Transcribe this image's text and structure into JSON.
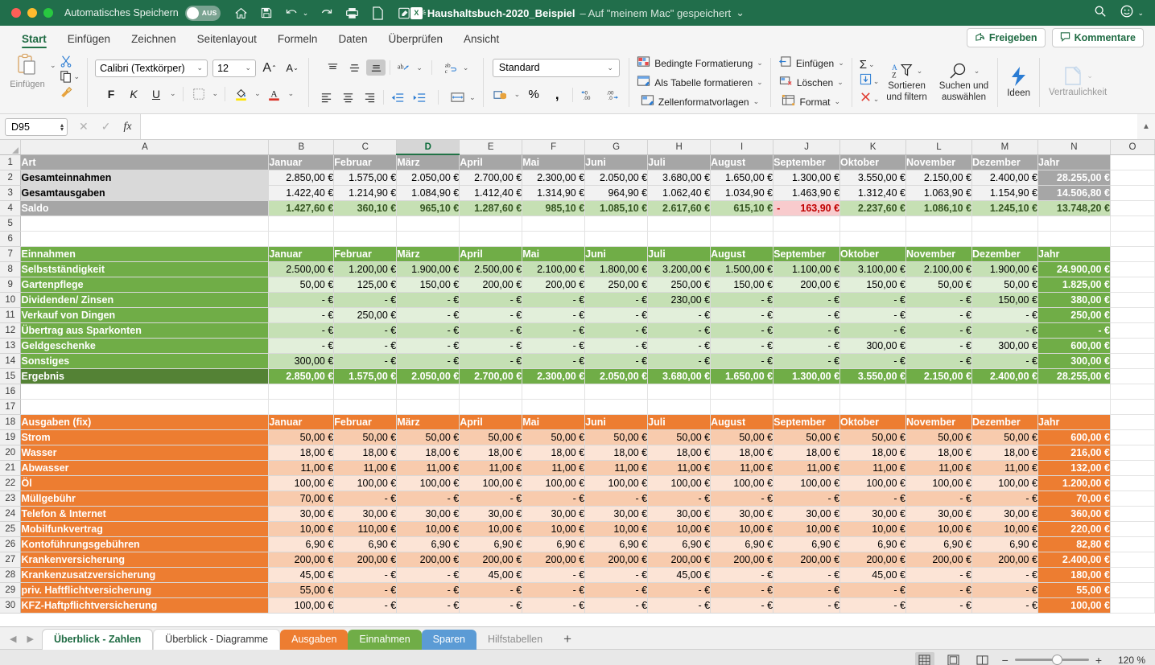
{
  "titlebar": {
    "autosave_label": "Automatisches Speichern",
    "autosave_state": "AUS",
    "doc_name": "Haushaltsbuch-2020_Beispiel",
    "doc_saved_text": "– Auf \"meinem Mac\" gespeichert",
    "quick_access": [
      "home-icon",
      "save-icon",
      "undo-icon",
      "redo-icon",
      "print-icon",
      "new-icon",
      "edit-icon",
      "more-icon"
    ],
    "right_icons": [
      "search-icon",
      "account-icon"
    ]
  },
  "ribbon_tabs": {
    "items": [
      "Start",
      "Einfügen",
      "Zeichnen",
      "Seitenlayout",
      "Formeln",
      "Daten",
      "Überprüfen",
      "Ansicht"
    ],
    "active": "Start",
    "share_label": "Freigeben",
    "comments_label": "Kommentare"
  },
  "ribbon": {
    "paste_label": "Einfügen",
    "font_name": "Calibri (Textkörper)",
    "font_size": "12",
    "bold": "F",
    "italic": "K",
    "underline": "U",
    "number_format": "Standard",
    "styles": [
      "Bedingte Formatierung",
      "Als Tabelle formatieren",
      "Zellenformatvorlagen"
    ],
    "cells": [
      "Einfügen",
      "Löschen",
      "Format"
    ],
    "sort_label": "Sortieren\nund filtern",
    "find_label": "Suchen und\nauswählen",
    "ideas_label": "Ideen",
    "sensitivity_label": "Vertraulichkeit"
  },
  "formulabar": {
    "namebox": "D95",
    "formula_value": ""
  },
  "grid": {
    "columns": [
      "A",
      "B",
      "C",
      "D",
      "E",
      "F",
      "G",
      "H",
      "I",
      "J",
      "K",
      "L",
      "M",
      "N",
      "O"
    ],
    "selected_column": "D",
    "months": [
      "Januar",
      "Februar",
      "März",
      "April",
      "Mai",
      "Juni",
      "Juli",
      "August",
      "September",
      "Oktober",
      "November",
      "Dezember"
    ],
    "year_label": "Jahr",
    "rows": [
      {
        "n": 1,
        "style": "summary-header",
        "label": "Art",
        "values": [
          "Januar",
          "Februar",
          "März",
          "April",
          "Mai",
          "Juni",
          "Juli",
          "August",
          "September",
          "Oktober",
          "November",
          "Dezember"
        ],
        "year": "Jahr"
      },
      {
        "n": 2,
        "style": "summary-body",
        "label": "Gesamteinnahmen",
        "values": [
          "2.850,00 €",
          "1.575,00 €",
          "2.050,00 €",
          "2.700,00 €",
          "2.300,00 €",
          "2.050,00 €",
          "3.680,00 €",
          "1.650,00 €",
          "1.300,00 €",
          "3.550,00 €",
          "2.150,00 €",
          "2.400,00 €"
        ],
        "year": "28.255,00 €"
      },
      {
        "n": 3,
        "style": "summary-body",
        "label": "Gesamtausgaben",
        "values": [
          "1.422,40 €",
          "1.214,90 €",
          "1.084,90 €",
          "1.412,40 €",
          "1.314,90 €",
          "964,90 €",
          "1.062,40 €",
          "1.034,90 €",
          "1.463,90 €",
          "1.312,40 €",
          "1.063,90 €",
          "1.154,90 €"
        ],
        "year": "14.506,80 €"
      },
      {
        "n": 4,
        "style": "summary-saldo",
        "label": "Saldo",
        "values": [
          "1.427,60 €",
          "360,10 €",
          "965,10 €",
          "1.287,60 €",
          "985,10 €",
          "1.085,10 €",
          "2.617,60 €",
          "615,10 €",
          "-  163,90 €",
          "2.237,60 €",
          "1.086,10 €",
          "1.245,10 €"
        ],
        "year": "13.748,20 €",
        "negative_index": 8
      },
      {
        "n": 5,
        "style": "empty"
      },
      {
        "n": 6,
        "style": "empty"
      },
      {
        "n": 7,
        "style": "income-header",
        "label": "Einnahmen",
        "values": [
          "Januar",
          "Februar",
          "März",
          "April",
          "Mai",
          "Juni",
          "Juli",
          "August",
          "September",
          "Oktober",
          "November",
          "Dezember"
        ],
        "year": "Jahr"
      },
      {
        "n": 8,
        "style": "income-a",
        "label": "Selbstständigkeit",
        "values": [
          "2.500,00 €",
          "1.200,00 €",
          "1.900,00 €",
          "2.500,00 €",
          "2.100,00 €",
          "1.800,00 €",
          "3.200,00 €",
          "1.500,00 €",
          "1.100,00 €",
          "3.100,00 €",
          "2.100,00 €",
          "1.900,00 €"
        ],
        "year": "24.900,00 €"
      },
      {
        "n": 9,
        "style": "income-b",
        "label": "Gartenpflege",
        "values": [
          "50,00 €",
          "125,00 €",
          "150,00 €",
          "200,00 €",
          "200,00 €",
          "250,00 €",
          "250,00 €",
          "150,00 €",
          "200,00 €",
          "150,00 €",
          "50,00 €",
          "50,00 €"
        ],
        "year": "1.825,00 €"
      },
      {
        "n": 10,
        "style": "income-a",
        "label": "Dividenden/ Zinsen",
        "values": [
          "-   €",
          "-   €",
          "-   €",
          "-   €",
          "-   €",
          "-   €",
          "230,00 €",
          "-   €",
          "-   €",
          "-   €",
          "-   €",
          "150,00 €"
        ],
        "year": "380,00 €"
      },
      {
        "n": 11,
        "style": "income-b",
        "label": "Verkauf von Dingen",
        "values": [
          "-   €",
          "250,00 €",
          "-   €",
          "-   €",
          "-   €",
          "-   €",
          "-   €",
          "-   €",
          "-   €",
          "-   €",
          "-   €",
          "-   €"
        ],
        "year": "250,00 €"
      },
      {
        "n": 12,
        "style": "income-a",
        "label": "Übertrag aus Sparkonten",
        "values": [
          "-   €",
          "-   €",
          "-   €",
          "-   €",
          "-   €",
          "-   €",
          "-   €",
          "-   €",
          "-   €",
          "-   €",
          "-   €",
          "-   €"
        ],
        "year": "-   €"
      },
      {
        "n": 13,
        "style": "income-b",
        "label": "Geldgeschenke",
        "values": [
          "-   €",
          "-   €",
          "-   €",
          "-   €",
          "-   €",
          "-   €",
          "-   €",
          "-   €",
          "-   €",
          "300,00 €",
          "-   €",
          "300,00 €"
        ],
        "year": "600,00 €"
      },
      {
        "n": 14,
        "style": "income-a",
        "label": "Sonstiges",
        "values": [
          "300,00 €",
          "-   €",
          "-   €",
          "-   €",
          "-   €",
          "-   €",
          "-   €",
          "-   €",
          "-   €",
          "-   €",
          "-   €",
          "-   €"
        ],
        "year": "300,00 €"
      },
      {
        "n": 15,
        "style": "income-result",
        "label": "Ergebnis",
        "values": [
          "2.850,00 €",
          "1.575,00 €",
          "2.050,00 €",
          "2.700,00 €",
          "2.300,00 €",
          "2.050,00 €",
          "3.680,00 €",
          "1.650,00 €",
          "1.300,00 €",
          "3.550,00 €",
          "2.150,00 €",
          "2.400,00 €"
        ],
        "year": "28.255,00 €"
      },
      {
        "n": 16,
        "style": "empty"
      },
      {
        "n": 17,
        "style": "empty"
      },
      {
        "n": 18,
        "style": "exp-header",
        "label": "Ausgaben (fix)",
        "values": [
          "Januar",
          "Februar",
          "März",
          "April",
          "Mai",
          "Juni",
          "Juli",
          "August",
          "September",
          "Oktober",
          "November",
          "Dezember"
        ],
        "year": "Jahr"
      },
      {
        "n": 19,
        "style": "exp-a",
        "label": "Strom",
        "values": [
          "50,00 €",
          "50,00 €",
          "50,00 €",
          "50,00 €",
          "50,00 €",
          "50,00 €",
          "50,00 €",
          "50,00 €",
          "50,00 €",
          "50,00 €",
          "50,00 €",
          "50,00 €"
        ],
        "year": "600,00 €"
      },
      {
        "n": 20,
        "style": "exp-b",
        "label": "Wasser",
        "values": [
          "18,00 €",
          "18,00 €",
          "18,00 €",
          "18,00 €",
          "18,00 €",
          "18,00 €",
          "18,00 €",
          "18,00 €",
          "18,00 €",
          "18,00 €",
          "18,00 €",
          "18,00 €"
        ],
        "year": "216,00 €"
      },
      {
        "n": 21,
        "style": "exp-a",
        "label": "Abwasser",
        "values": [
          "11,00 €",
          "11,00 €",
          "11,00 €",
          "11,00 €",
          "11,00 €",
          "11,00 €",
          "11,00 €",
          "11,00 €",
          "11,00 €",
          "11,00 €",
          "11,00 €",
          "11,00 €"
        ],
        "year": "132,00 €"
      },
      {
        "n": 22,
        "style": "exp-b",
        "label": "Öl",
        "values": [
          "100,00 €",
          "100,00 €",
          "100,00 €",
          "100,00 €",
          "100,00 €",
          "100,00 €",
          "100,00 €",
          "100,00 €",
          "100,00 €",
          "100,00 €",
          "100,00 €",
          "100,00 €"
        ],
        "year": "1.200,00 €"
      },
      {
        "n": 23,
        "style": "exp-a",
        "label": "Müllgebühr",
        "values": [
          "70,00 €",
          "-   €",
          "-   €",
          "-   €",
          "-   €",
          "-   €",
          "-   €",
          "-   €",
          "-   €",
          "-   €",
          "-   €",
          "-   €"
        ],
        "year": "70,00 €"
      },
      {
        "n": 24,
        "style": "exp-b",
        "label": "Telefon & Internet",
        "values": [
          "30,00 €",
          "30,00 €",
          "30,00 €",
          "30,00 €",
          "30,00 €",
          "30,00 €",
          "30,00 €",
          "30,00 €",
          "30,00 €",
          "30,00 €",
          "30,00 €",
          "30,00 €"
        ],
        "year": "360,00 €"
      },
      {
        "n": 25,
        "style": "exp-a",
        "label": "Mobilfunkvertrag",
        "values": [
          "10,00 €",
          "110,00 €",
          "10,00 €",
          "10,00 €",
          "10,00 €",
          "10,00 €",
          "10,00 €",
          "10,00 €",
          "10,00 €",
          "10,00 €",
          "10,00 €",
          "10,00 €"
        ],
        "year": "220,00 €"
      },
      {
        "n": 26,
        "style": "exp-b",
        "label": "Kontoführungsgebühren",
        "values": [
          "6,90 €",
          "6,90 €",
          "6,90 €",
          "6,90 €",
          "6,90 €",
          "6,90 €",
          "6,90 €",
          "6,90 €",
          "6,90 €",
          "6,90 €",
          "6,90 €",
          "6,90 €"
        ],
        "year": "82,80 €"
      },
      {
        "n": 27,
        "style": "exp-a",
        "label": "Krankenversicherung",
        "values": [
          "200,00 €",
          "200,00 €",
          "200,00 €",
          "200,00 €",
          "200,00 €",
          "200,00 €",
          "200,00 €",
          "200,00 €",
          "200,00 €",
          "200,00 €",
          "200,00 €",
          "200,00 €"
        ],
        "year": "2.400,00 €"
      },
      {
        "n": 28,
        "style": "exp-b",
        "label": "Krankenzusatzversicherung",
        "values": [
          "45,00 €",
          "-   €",
          "-   €",
          "45,00 €",
          "-   €",
          "-   €",
          "45,00 €",
          "-   €",
          "-   €",
          "45,00 €",
          "-   €",
          "-   €"
        ],
        "year": "180,00 €"
      },
      {
        "n": 29,
        "style": "exp-a",
        "label": "priv. Haftflichtversicherung",
        "values": [
          "55,00 €",
          "-   €",
          "-   €",
          "-   €",
          "-   €",
          "-   €",
          "-   €",
          "-   €",
          "-   €",
          "-   €",
          "-   €",
          "-   €"
        ],
        "year": "55,00 €"
      },
      {
        "n": 30,
        "style": "exp-b",
        "label": "KFZ-Haftpflichtversicherung",
        "values": [
          "100,00 €",
          "-   €",
          "-   €",
          "-   €",
          "-   €",
          "-   €",
          "-   €",
          "-   €",
          "-   €",
          "-   €",
          "-   €",
          "-   €"
        ],
        "year": "100,00 €"
      }
    ]
  },
  "sheettabs": {
    "items": [
      {
        "label": "Überblick - Zahlen",
        "style": "active"
      },
      {
        "label": "Überblick - Diagramme",
        "style": "plain"
      },
      {
        "label": "Ausgaben",
        "style": "orange"
      },
      {
        "label": "Einnahmen",
        "style": "green"
      },
      {
        "label": "Sparen",
        "style": "blue"
      },
      {
        "label": "Hilfstabellen",
        "style": "dim"
      }
    ],
    "add_label": "+"
  },
  "statusbar": {
    "zoom_level": "120 %",
    "zoom_out": "−",
    "zoom_in": "+",
    "views": [
      "normal-view-icon",
      "page-layout-icon",
      "page-break-icon"
    ]
  },
  "colors": {
    "brand_green": "#217346",
    "income_green": "#70ad47",
    "expense_orange": "#ed7d31",
    "saving_blue": "#5b9bd5",
    "negative_red": "#c00000"
  }
}
